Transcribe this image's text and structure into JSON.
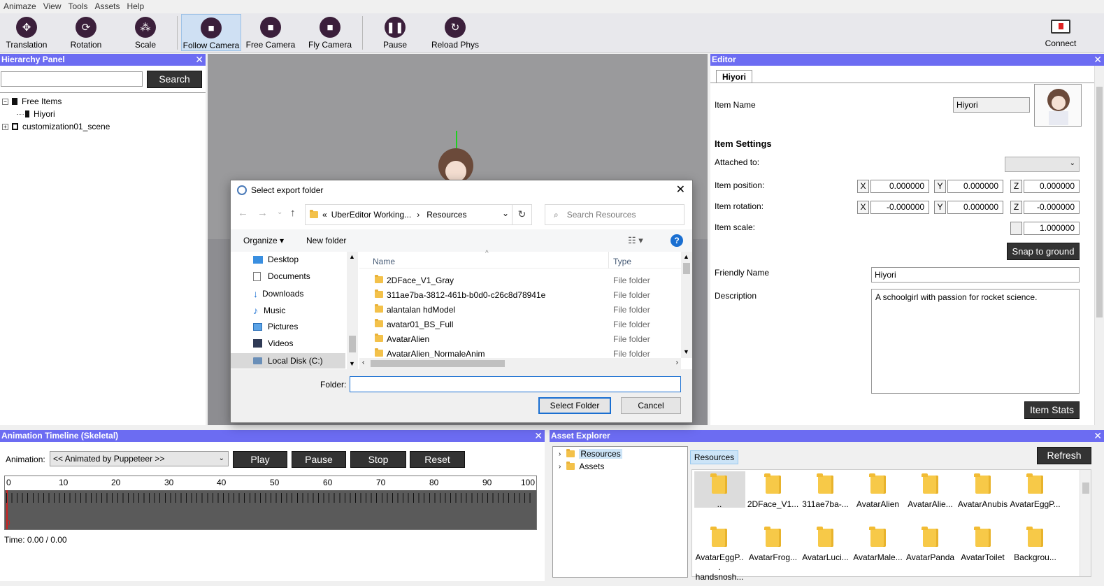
{
  "menubar": {
    "items": [
      "Animaze",
      "View",
      "Tools",
      "Assets",
      "Help"
    ]
  },
  "toolbar": {
    "translation": "Translation",
    "rotation": "Rotation",
    "scale": "Scale",
    "follow_camera": "Follow Camera",
    "free_camera": "Free Camera",
    "fly_camera": "Fly Camera",
    "pause": "Pause",
    "reload_phys": "Reload Phys",
    "connect": "Connect"
  },
  "hierarchy": {
    "title": "Hierarchy Panel",
    "search_button": "Search",
    "search_value": "",
    "tree": {
      "free_items": "Free Items",
      "hiyori": "Hiyori",
      "scene": "customization01_scene"
    }
  },
  "editor": {
    "title": "Editor",
    "tab": "Hiyori",
    "item_name_label": "Item Name",
    "item_name_value": "Hiyori",
    "settings_header": "Item Settings",
    "attached_to_label": "Attached to:",
    "attached_to_value": "",
    "position_label": "Item position:",
    "rotation_label": "Item rotation:",
    "scale_label": "Item scale:",
    "x": "X",
    "y": "Y",
    "z": "Z",
    "pos_x": "0.000000",
    "pos_y": "0.000000",
    "pos_z": "0.000000",
    "rot_x": "-0.000000",
    "rot_y": "0.000000",
    "rot_z": "-0.000000",
    "scale_value": "1.000000",
    "snap_button": "Snap to ground",
    "friendly_label": "Friendly Name",
    "friendly_value": "Hiyori",
    "description_label": "Description",
    "description_value": "A schoolgirl with passion for rocket science.",
    "item_stats_button": "Item Stats"
  },
  "timeline": {
    "title": "Animation Timeline (Skeletal)",
    "animation_label": "Animation:",
    "animation_value": "<< Animated by Puppeteer >>",
    "play": "Play",
    "pause": "Pause",
    "stop": "Stop",
    "reset": "Reset",
    "ticks": [
      "0",
      "10",
      "20",
      "30",
      "40",
      "50",
      "60",
      "70",
      "80",
      "90",
      "100"
    ],
    "cursor_label": "0",
    "time_text": "Time: 0.00 / 0.00"
  },
  "assets": {
    "title": "Asset Explorer",
    "tree": [
      "Resources",
      "Assets"
    ],
    "breadcrumb": "Resources",
    "refresh": "Refresh",
    "items_row1": [
      "..",
      "2DFace_V1...",
      "311ae7ba-...",
      "AvatarAlien",
      "AvatarAlie...",
      "AvatarAnubis",
      "AvatarEggP..."
    ],
    "items_row2": [
      "AvatarEggP... handsnosh...",
      "AvatarFrog...",
      "AvatarLuci...",
      "AvatarMale...",
      "AvatarPanda",
      "AvatarToilet",
      "Backgrou..."
    ]
  },
  "dialog": {
    "title": "Select export folder",
    "path_prefix": "«",
    "path_1": "UberEditor Working...",
    "path_sep": "›",
    "path_2": "Resources",
    "search_placeholder": "Search Resources",
    "organize": "Organize ▾",
    "new_folder": "New folder",
    "help": "?",
    "nav": [
      "Desktop",
      "Documents",
      "Downloads",
      "Music",
      "Pictures",
      "Videos",
      "Local Disk (C:)"
    ],
    "col_name": "Name",
    "col_type": "Type",
    "files": [
      {
        "name": "2DFace_V1_Gray",
        "type": "File folder"
      },
      {
        "name": "311ae7ba-3812-461b-b0d0-c26c8d78941e",
        "type": "File folder"
      },
      {
        "name": "alantalan hdModel",
        "type": "File folder"
      },
      {
        "name": "avatar01_BS_Full",
        "type": "File folder"
      },
      {
        "name": "AvatarAlien",
        "type": "File folder"
      },
      {
        "name": "AvatarAlien_NormaleAnim",
        "type": "File folder"
      }
    ],
    "folder_label": "Folder:",
    "folder_value": "",
    "select_button": "Select Folder",
    "cancel_button": "Cancel"
  }
}
